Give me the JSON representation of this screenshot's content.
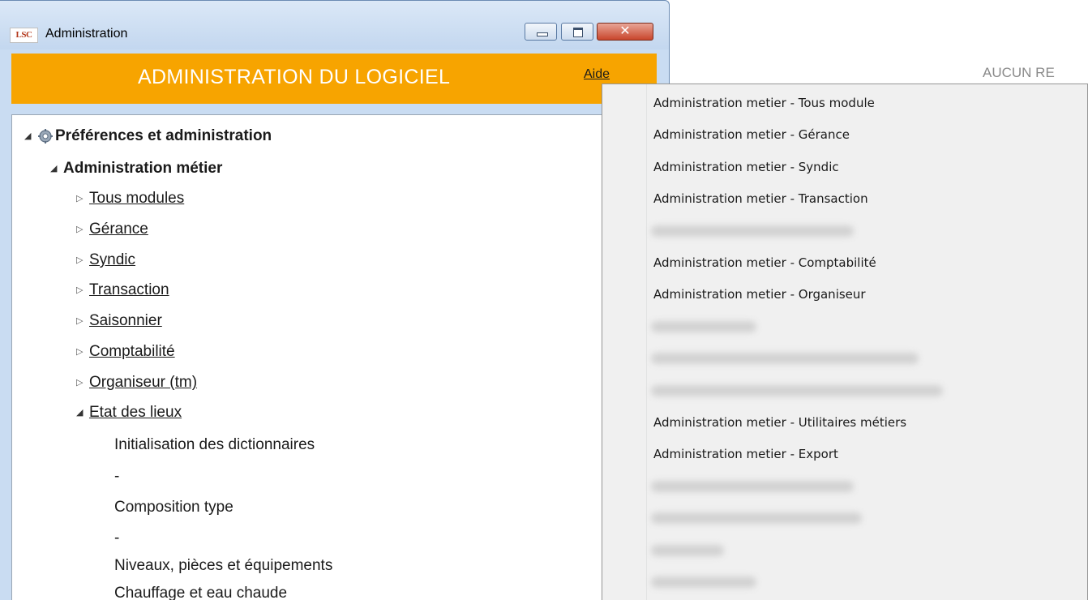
{
  "window": {
    "app_icon_text": "LSC",
    "title": "Administration",
    "close_glyph": "✕"
  },
  "header": {
    "title": "ADMINISTRATION DU LOGICIEL",
    "help_label": "Aide"
  },
  "background": {
    "status_text": "AUCUN RE"
  },
  "tree": {
    "root": {
      "label": "Préférences et administration",
      "icon": "gear-icon",
      "expanded": true
    },
    "group": {
      "label": "Administration métier",
      "expanded": true
    },
    "modules": [
      {
        "label": "Tous modules",
        "expanded": false
      },
      {
        "label": "Gérance",
        "expanded": false
      },
      {
        "label": "Syndic",
        "expanded": false
      },
      {
        "label": "Transaction",
        "expanded": false
      },
      {
        "label": "Saisonnier",
        "expanded": false
      },
      {
        "label": "Comptabilité",
        "expanded": false
      },
      {
        "label": "Organiseur (tm)",
        "expanded": false
      },
      {
        "label": "Etat des lieux",
        "expanded": true
      }
    ],
    "etat_children": [
      "Initialisation des dictionnaires",
      "-",
      "Composition type",
      "-",
      "Niveaux, pièces et équipements",
      "Chauffage et eau chaude"
    ]
  },
  "menu": {
    "items": [
      {
        "label": "Administration metier - Tous module",
        "blurred": false
      },
      {
        "label": "Administration metier - Gérance",
        "blurred": false
      },
      {
        "label": "Administration metier - Syndic",
        "blurred": false
      },
      {
        "label": "Administration metier - Transaction",
        "blurred": false
      },
      {
        "label": "",
        "blurred": true
      },
      {
        "label": "Administration metier - Comptabilité",
        "blurred": false
      },
      {
        "label": "Administration metier - Organiseur",
        "blurred": false
      },
      {
        "label": "",
        "blurred": true
      },
      {
        "label": "",
        "blurred": true
      },
      {
        "label": "",
        "blurred": true
      },
      {
        "label": "Administration metier - Utilitaires métiers",
        "blurred": false
      },
      {
        "label": "Administration metier - Export",
        "blurred": false
      },
      {
        "label": "",
        "blurred": true
      },
      {
        "label": "",
        "blurred": true
      },
      {
        "label": "",
        "blurred": true
      },
      {
        "label": "",
        "blurred": true
      }
    ]
  },
  "colors": {
    "header_orange": "#f7a400",
    "title_bar": "#c9dcf2",
    "close_red": "#c9462c"
  }
}
